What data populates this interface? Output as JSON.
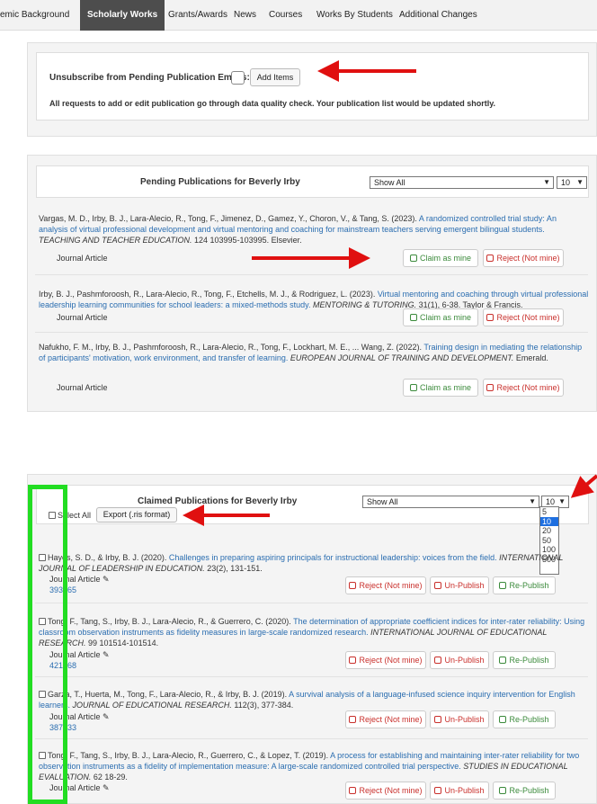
{
  "tabs": [
    {
      "label": "emic Background",
      "active": false
    },
    {
      "label": "Scholarly Works",
      "active": true
    },
    {
      "label": "Grants/Awards",
      "active": false
    },
    {
      "label": "News",
      "active": false
    },
    {
      "label": "Courses",
      "active": false
    },
    {
      "label": "Works By Students",
      "active": false
    },
    {
      "label": "Additional Changes",
      "active": false
    }
  ],
  "unsubscribe": {
    "label": "Unsubscribe from Pending Publication Emails:",
    "add_button": "Add Items",
    "note": "All requests to add or edit publication go through data quality check. Your publication list would be updated shortly."
  },
  "pending": {
    "title": "Pending Publications for Beverly Irby",
    "filter_value": "Show All",
    "count_value": "10",
    "claim_label": "Claim as mine",
    "reject_label": "Reject (Not mine)",
    "items": [
      {
        "authors": "Vargas, M. D., Irby, B. J., Lara-Alecio, R., Tong, F., Jimenez, D., Gamez, Y., Choron, V., & Tang, S. (2023). ",
        "title": "A randomized controlled trial study: An analysis of virtual professional development and virtual mentoring and coaching for mainstream teachers serving emergent bilingual students.",
        "journal": "TEACHING AND TEACHER EDUCATION.",
        "rest": " 124 103995-103995. Elsevier.",
        "type": "Journal Article"
      },
      {
        "authors": "Irby, B. J., Pashmforoosh, R., Lara-Alecio, R., Tong, F., Etchells, M. J., & Rodriguez, L. (2023). ",
        "title": "Virtual mentoring and coaching through virtual professional leadership learning communities for school leaders: a mixed-methods study.",
        "journal": " MENTORING & TUTORING.",
        "rest": " 31(1), 6-38. Taylor & Francis.",
        "type": "Journal Article"
      },
      {
        "authors": "Nafukho, F. M., Irby, B. J., Pashmforoosh, R., Lara-Alecio, R., Tong, F., Lockhart, M. E., ... Wang, Z. (2022). ",
        "title": "Training design in mediating the relationship of participants' motivation, work environment, and transfer of learning.",
        "journal": " EUROPEAN JOURNAL OF TRAINING AND DEVELOPMENT.",
        "rest": " Emerald.",
        "type": "Journal Article"
      }
    ]
  },
  "claimed": {
    "title": "Claimed Publications for Beverly Irby",
    "select_all": "Select All",
    "export_button": "Export (.ris format)",
    "filter_value": "Show All",
    "count_value": "10",
    "count_options": [
      "5",
      "10",
      "20",
      "50",
      "100",
      "500"
    ],
    "count_selected_index": 1,
    "reject_label": "Reject (Not mine)",
    "unpublish_label": "Un-Publish",
    "republish_label": "Re-Publish",
    "items": [
      {
        "authors": "Hayes, S. D., & Irby, B. J. (2020). ",
        "title": "Challenges in preparing aspiring principals for instructional leadership: voices from the field.",
        "journal": " INTERNATIONAL JOURNAL OF LEADERSHIP IN EDUCATION.",
        "rest": " 23(2), 131-151.",
        "type": "Journal Article",
        "id": "393265"
      },
      {
        "authors": "Tong, F., Tang, S., Irby, B. J., Lara-Alecio, R., & Guerrero, C. (2020). ",
        "title": "The determination of appropriate coefficient indices for inter-rater reliability: Using classroom observation instruments as fidelity measures in large-scale randomized research.",
        "journal": " INTERNATIONAL JOURNAL OF EDUCATIONAL RESEARCH.",
        "rest": " 99 101514-101514.",
        "type": "Journal Article",
        "id": "421968"
      },
      {
        "authors": "Garza, T., Huerta, M., Tong, F., Lara-Alecio, R., & Irby, B. J. (2019). ",
        "title": "A survival analysis of a language-infused science inquiry intervention for English learners.",
        "journal": " JOURNAL OF EDUCATIONAL RESEARCH.",
        "rest": " 112(3), 377-384.",
        "type": "Journal Article",
        "id": "387033"
      },
      {
        "authors": "Tong, F., Tang, S., Irby, B. J., Lara-Alecio, R., Guerrero, C., & Lopez, T. (2019). ",
        "title": "A process for establishing and maintaining inter-rater reliability for two observation instruments as a fidelity of implementation measure: A large-scale randomized controlled trial perspective.",
        "journal": " STUDIES IN EDUCATIONAL EVALUATION.",
        "rest": " 62 18-29.",
        "type": "Journal Article",
        "id": ""
      }
    ]
  },
  "colors": {
    "active_tab": "#4d4d4d",
    "link": "#2a6db0",
    "green": "#3b8a3b",
    "red": "#c9302c",
    "annotation_arrow": "#e01010",
    "annotation_box": "#22dd22",
    "dropdown_selected": "#1e6fe0"
  }
}
